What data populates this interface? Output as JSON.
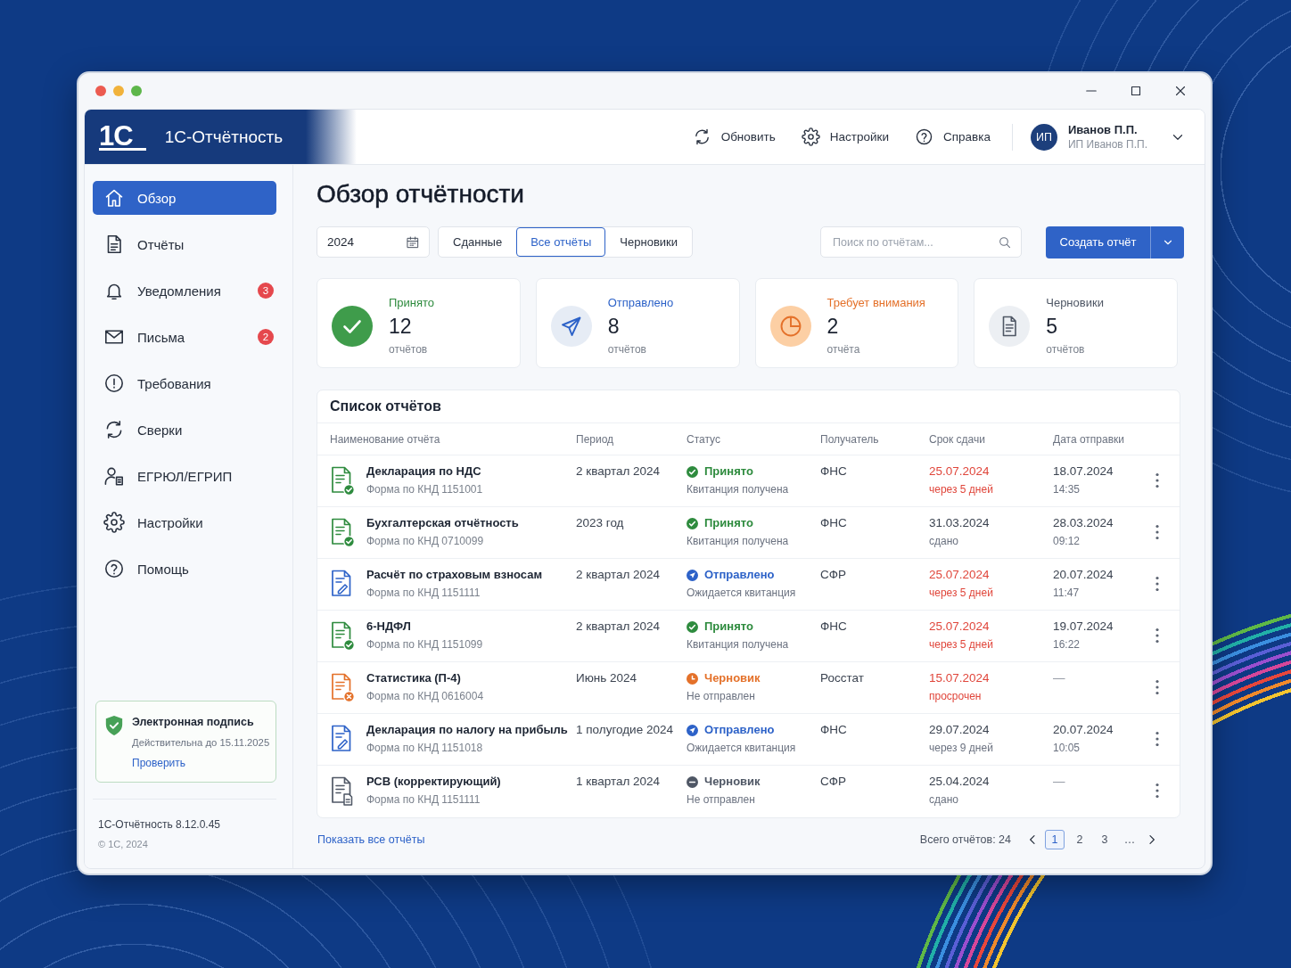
{
  "header": {
    "logo_mark": "1С",
    "app_name": "1С-Отчётность",
    "actions": [
      {
        "label": "Обновить"
      },
      {
        "label": "Настройки"
      },
      {
        "label": "Справка"
      }
    ],
    "user": {
      "initials": "ИП",
      "name": "Иванов П.П.",
      "org": "ИП Иванов П.П."
    }
  },
  "sidebar": {
    "items": [
      {
        "label": "Обзор",
        "selected": true
      },
      {
        "label": "Отчёты",
        "selected": false
      },
      {
        "label": "Уведомления",
        "selected": false,
        "badge": "3"
      },
      {
        "label": "Письма",
        "selected": false,
        "badge": "2"
      },
      {
        "label": "Требования",
        "selected": false
      },
      {
        "label": "Сверки",
        "selected": false
      },
      {
        "label": "ЕГРЮЛ/ЕГРИП",
        "selected": false
      },
      {
        "label": "Настройки",
        "selected": false
      },
      {
        "label": "Помощь",
        "selected": false
      }
    ],
    "signature": {
      "title": "Электронная подпись",
      "validity": "Действительна до 15.11.2025",
      "link": "Проверить"
    },
    "version": "1С-Отчётность 8.12.0.45",
    "copyright": "© 1С, 2024"
  },
  "main": {
    "title": "Обзор отчётности",
    "filters": {
      "year": "2024",
      "segments": [
        {
          "label": "Сданные",
          "selected": false
        },
        {
          "label": "Все отчёты",
          "selected": true
        },
        {
          "label": "Черновики",
          "selected": false
        }
      ],
      "search": {
        "placeholder": "Поиск по отчётам..."
      },
      "create_button": "Создать отчёт"
    },
    "stats": [
      {
        "kind": "accepted",
        "label": "Принято",
        "value": "12",
        "unit": "отчётов"
      },
      {
        "kind": "sent",
        "label": "Отправлено",
        "value": "8",
        "unit": "отчётов"
      },
      {
        "kind": "warning",
        "label": "Требует внимания",
        "value": "2",
        "unit": "отчёта"
      },
      {
        "kind": "draft",
        "label": "Черновики",
        "value": "5",
        "unit": "отчётов"
      }
    ],
    "table": {
      "title": "Список отчётов",
      "columns": [
        "Наименование отчёта",
        "Период",
        "Статус",
        "Получатель",
        "Срок сдачи",
        "Дата отправки"
      ],
      "rows": [
        {
          "name": "Декларация по НДС",
          "form": "Форма по КНД 1151001",
          "period": "2 квартал 2024",
          "status": {
            "kind": "accepted",
            "label": "Принято",
            "note": "Квитанция получена"
          },
          "recipient": "ФНС",
          "deadline": {
            "date": "25.07.2024",
            "note": "через 5 дней",
            "urgent": true
          },
          "sent": {
            "date": "18.07.2024",
            "time": "14:35"
          }
        },
        {
          "name": "Бухгалтерская отчётность",
          "form": "Форма по КНД 0710099",
          "period": "2023 год",
          "status": {
            "kind": "accepted",
            "label": "Принято",
            "note": "Квитанция получена"
          },
          "recipient": "ФНС",
          "deadline": {
            "date": "31.03.2024",
            "note": "сдано",
            "urgent": false
          },
          "sent": {
            "date": "28.03.2024",
            "time": "09:12"
          }
        },
        {
          "name": "Расчёт по страховым взносам",
          "form": "Форма по КНД 1151111",
          "period": "2 квартал 2024",
          "status": {
            "kind": "sent",
            "label": "Отправлено",
            "note": "Ожидается квитанция"
          },
          "recipient": "СФР",
          "deadline": {
            "date": "25.07.2024",
            "note": "через 5 дней",
            "urgent": true
          },
          "sent": {
            "date": "20.07.2024",
            "time": "11:47"
          }
        },
        {
          "name": "6-НДФЛ",
          "form": "Форма по КНД 1151099",
          "period": "2 квартал 2024",
          "status": {
            "kind": "accepted",
            "label": "Принято",
            "note": "Квитанция получена"
          },
          "recipient": "ФНС",
          "deadline": {
            "date": "25.07.2024",
            "note": "через 5 дней",
            "urgent": true
          },
          "sent": {
            "date": "19.07.2024",
            "time": "16:22"
          }
        },
        {
          "name": "Статистика (П-4)",
          "form": "Форма по КНД 0616004",
          "period": "Июнь 2024",
          "status": {
            "kind": "warning",
            "label": "Черновик",
            "note": "Не отправлен"
          },
          "recipient": "Росстат",
          "deadline": {
            "date": "15.07.2024",
            "note": "просрочен",
            "urgent": true
          },
          "sent": {
            "date": "—"
          }
        },
        {
          "name": "Декларация по налогу на прибыль",
          "form": "Форма по КНД 1151018",
          "period": "1 полугодие 2024",
          "status": {
            "kind": "sent",
            "label": "Отправлено",
            "note": "Ожидается квитанция"
          },
          "recipient": "ФНС",
          "deadline": {
            "date": "29.07.2024",
            "note": "через 9 дней",
            "urgent": false
          },
          "sent": {
            "date": "20.07.2024",
            "time": "10:05"
          }
        },
        {
          "name": "РСВ (корректирующий)",
          "form": "Форма по КНД 1151111",
          "period": "1 квартал 2024",
          "status": {
            "kind": "draft",
            "label": "Черновик",
            "note": "Не отправлен"
          },
          "recipient": "СФР",
          "deadline": {
            "date": "25.04.2024",
            "note": "сдано",
            "urgent": false
          },
          "sent": {
            "date": "—"
          }
        }
      ]
    },
    "show_all_link": "Показать все отчёты",
    "pagination": {
      "total": "Всего отчётов: 24",
      "pages": [
        {
          "label": "1",
          "selected": true
        },
        {
          "label": "2",
          "selected": false
        },
        {
          "label": "3",
          "selected": false
        }
      ],
      "ellipsis": "…"
    }
  }
}
